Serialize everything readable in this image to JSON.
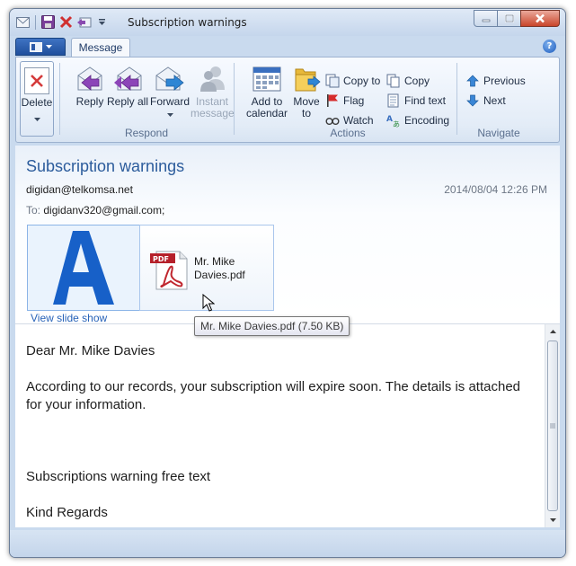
{
  "window": {
    "title": "Subscription warnings"
  },
  "ribbon": {
    "tab": "Message",
    "groups": {
      "delete": {
        "label": "Delete"
      },
      "respond": {
        "label": "Respond",
        "reply": "Reply",
        "reply_all": "Reply all",
        "forward": "Forward",
        "instant": "Instant message"
      },
      "actions": {
        "label": "Actions",
        "add_calendar": "Add to calendar",
        "move_to": "Move to",
        "copy_to": "Copy to",
        "flag": "Flag",
        "watch": "Watch",
        "copy": "Copy",
        "find_text": "Find text",
        "encoding": "Encoding"
      },
      "navigate": {
        "label": "Navigate",
        "previous": "Previous",
        "next": "Next"
      }
    }
  },
  "message": {
    "subject": "Subscription warnings",
    "from": "digidan@telkomsa.net",
    "date": "2014/08/04 12:26 PM",
    "to_label": "To:",
    "to": "digidanv320@gmail.com;",
    "attachment": {
      "name_line1": "Mr. Mike",
      "name_line2": "Davies.pdf",
      "tooltip": "Mr. Mike Davies.pdf (7.50 KB)",
      "icon_text": "PDF"
    },
    "view_slideshow": "View slide show",
    "body": {
      "greeting": "Dear Mr. Mike Davies",
      "paragraph": "According to our records, your subscription will expire soon. The details is attached for your information.",
      "free_text": "Subscriptions warning free text",
      "closing": "Kind Regards"
    }
  }
}
